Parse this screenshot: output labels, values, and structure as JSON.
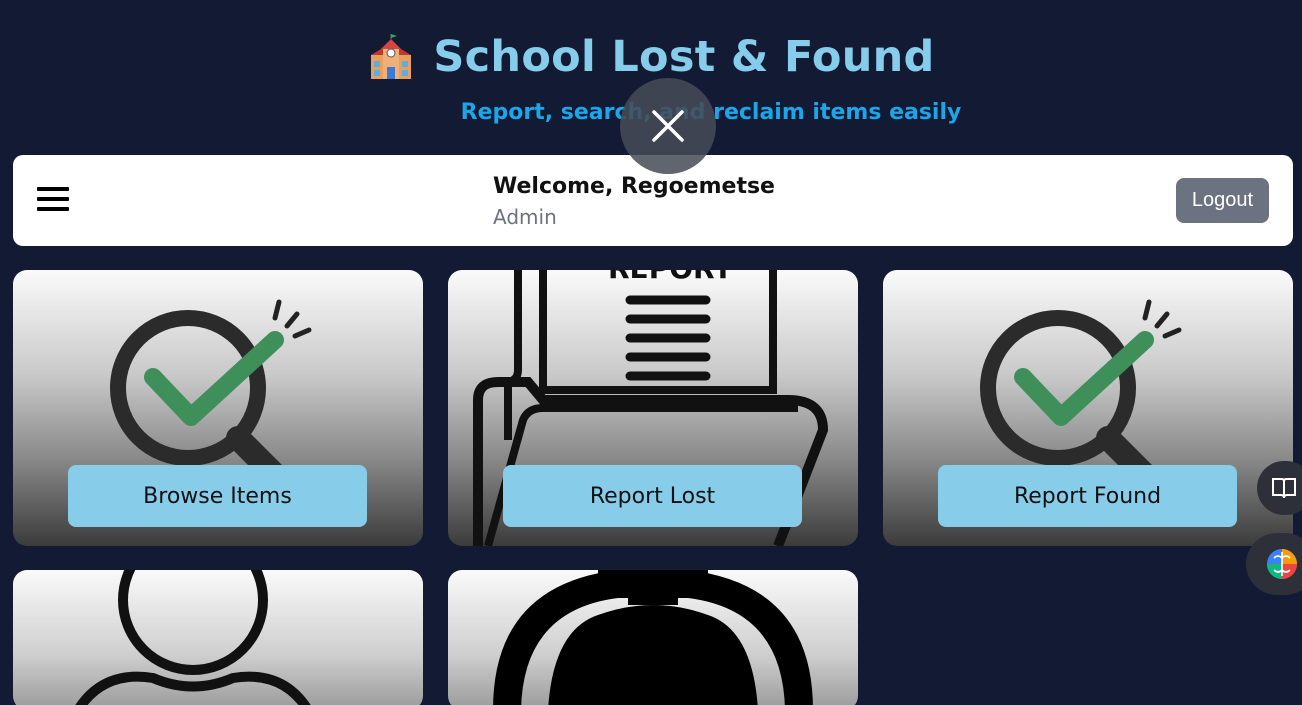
{
  "header": {
    "icon": "school-icon",
    "title": "School Lost & Found",
    "subtitle": "Report, search, and reclaim items easily"
  },
  "overlay": {
    "icon": "close-icon"
  },
  "topbar": {
    "menu_icon": "hamburger-menu-icon",
    "welcome": "Welcome, Regoemetse",
    "role": "Admin",
    "logout_label": "Logout"
  },
  "cards": [
    {
      "image": "magnifier-check-icon",
      "label": "Browse Items"
    },
    {
      "image": "report-folder-icon",
      "label": "Report Lost"
    },
    {
      "image": "magnifier-check-icon",
      "label": "Report Found"
    },
    {
      "image": "user-profile-icon",
      "label": ""
    },
    {
      "image": "bell-icon",
      "label": ""
    }
  ],
  "floating": [
    "reader-mode-icon",
    "brain-assistant-icon"
  ],
  "colors": {
    "background": "#121a34",
    "title": "#86cdeb",
    "subtitle": "#1aa6e8",
    "card_button": "#87cdea",
    "logout_button": "#6b7280"
  }
}
